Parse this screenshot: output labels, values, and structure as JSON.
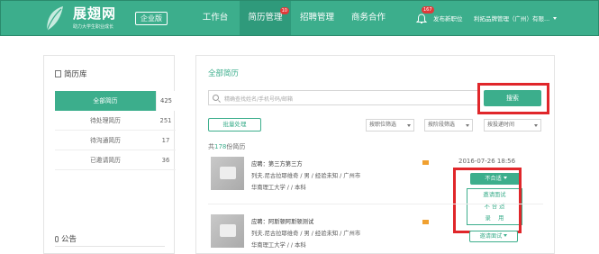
{
  "header": {
    "logo_text": "展翅网",
    "logo_sub": "助力大学生职业成长",
    "edition": "企业版",
    "nav": [
      {
        "label": "工作台"
      },
      {
        "label": "简历管理",
        "badge": "10"
      },
      {
        "label": "招聘管理"
      },
      {
        "label": "商务合作"
      }
    ],
    "notifications_badge": "167",
    "publish_label": "发布新职位",
    "company_label": "利拓品牌管理（广州）有限..."
  },
  "sidebar": {
    "title": "简历库",
    "items": [
      {
        "label": "全部简历",
        "count": "425"
      },
      {
        "label": "待处理简历",
        "count": "251"
      },
      {
        "label": "待沟通简历",
        "count": "17"
      },
      {
        "label": "已邀请简历",
        "count": "36"
      }
    ],
    "notice_title": "公告"
  },
  "main": {
    "title": "全部简历",
    "search_placeholder": "精确查找姓名/手机号码/邮箱",
    "search_button": "搜索",
    "bulk_button": "批量处理",
    "filters": [
      "按职位筛选",
      "按阶段筛选",
      "按投递时间"
    ],
    "total_prefix": "共",
    "total_count": "178",
    "total_suffix": "份简历"
  },
  "resumes": [
    {
      "position": "应聘：第三方第三方",
      "info": "列夫.尼古拉耶维奇 / 男 / 经验未知 / 广州市",
      "education": "华南理工大学 / / 本科",
      "date": "2016-07-26 18:56",
      "status": "不合适",
      "menu": [
        "邀请面试",
        "不 合 适",
        "录　 用"
      ]
    },
    {
      "position": "应聘：阿斯顿阿斯顿测试",
      "info": "列夫.尼古拉耶维奇 / 男 / 经验未知 / 广州市",
      "education": "华南理工大学 / / 本科",
      "status": "邀请面试"
    }
  ],
  "colors": {
    "brand": "#3cae8c",
    "highlight": "#e0262a",
    "badge": "#e03a3a"
  }
}
